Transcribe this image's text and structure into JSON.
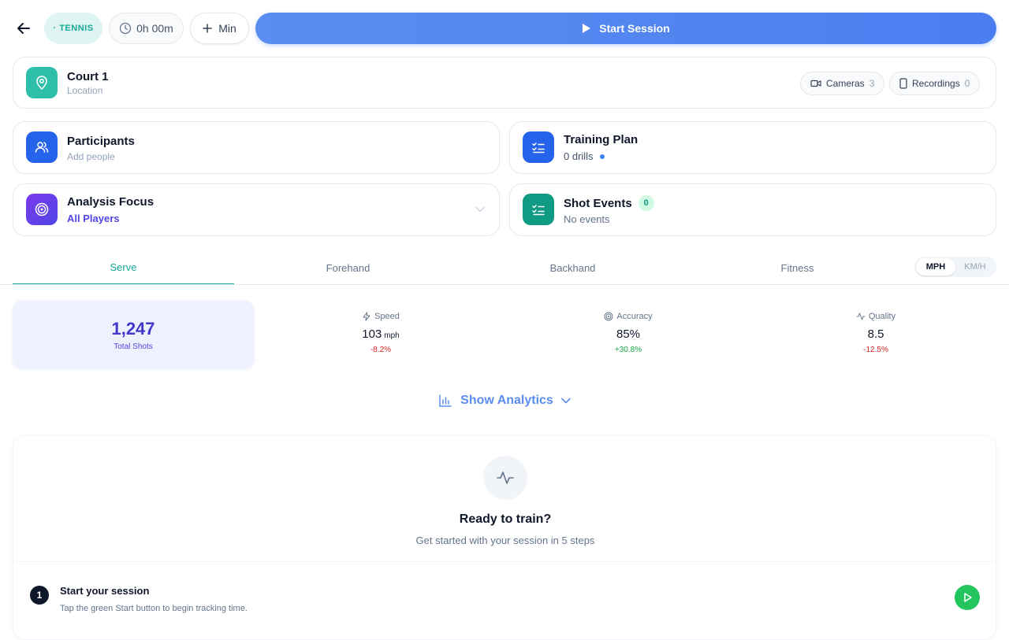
{
  "header": {
    "sport_label": "· TENNIS",
    "timer": "0h 00m",
    "min_label": "Min",
    "start_label": "Start Session"
  },
  "location": {
    "title": "Court 1",
    "subtitle": "Location",
    "cameras_label": "Cameras",
    "cameras_count": "3",
    "recordings_label": "Recordings",
    "recordings_count": "0"
  },
  "participants": {
    "title": "Participants",
    "subtitle": "Add people"
  },
  "training_plan": {
    "title": "Training Plan",
    "subtitle": "0 drills"
  },
  "analysis_focus": {
    "title": "Analysis Focus",
    "value": "All Players"
  },
  "shot_events": {
    "title": "Shot Events",
    "badge": "0",
    "subtitle": "No events"
  },
  "tabs": [
    {
      "label": "Serve"
    },
    {
      "label": "Forehand"
    },
    {
      "label": "Backhand"
    },
    {
      "label": "Fitness"
    }
  ],
  "units": {
    "mph": "MPH",
    "kmh": "KM/H"
  },
  "total": {
    "value": "1,247",
    "label": "Total Shots"
  },
  "metrics": {
    "speed": {
      "label": "Speed",
      "value": "103",
      "unit": "mph",
      "delta": "-8.2%"
    },
    "accuracy": {
      "label": "Accuracy",
      "value": "85%",
      "delta": "+30.8%"
    },
    "quality": {
      "label": "Quality",
      "value": "8.5",
      "delta": "-12.5%"
    }
  },
  "analytics_label": "Show Analytics",
  "ready": {
    "title": "Ready to train?",
    "subtitle": "Get started with your session in 5 steps",
    "step_number": "1",
    "step_title": "Start your session",
    "step_desc": "Tap the green Start button to begin tracking time."
  },
  "colors": {
    "accent_teal": "#14a899",
    "primary_blue": "#4a7ef0",
    "indigo": "#4338ca",
    "negative": "#dc2626",
    "positive": "#16a34a",
    "go_green": "#22c55e"
  }
}
